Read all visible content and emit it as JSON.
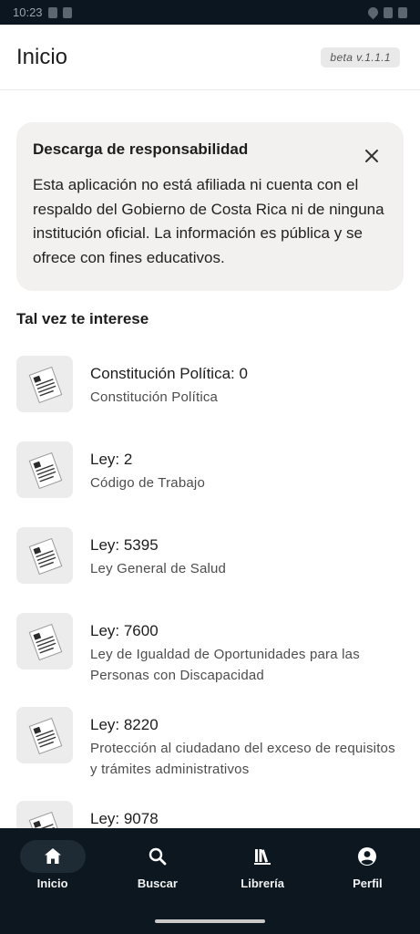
{
  "status_bar": {
    "time": "10:23"
  },
  "app_bar": {
    "title": "Inicio",
    "version": "beta v.1.1.1"
  },
  "disclaimer": {
    "title": "Descarga de responsabilidad",
    "body": "Esta aplicación no está afiliada ni cuenta con el respaldo del Gobierno de Costa Rica ni de ninguna institución oficial. La información es pública y se ofrece con fines educativos."
  },
  "section": {
    "title": "Tal vez te interese"
  },
  "items": [
    {
      "title": "Constitución Política: 0",
      "subtitle": "Constitución Política",
      "icon": "document-icon"
    },
    {
      "title": "Ley: 2",
      "subtitle": "Código de Trabajo",
      "icon": "document-icon"
    },
    {
      "title": "Ley: 5395",
      "subtitle": "Ley General de Salud",
      "icon": "document-icon"
    },
    {
      "title": "Ley: 7600",
      "subtitle": "Ley de Igualdad de Oportunidades para las Personas con Discapacidad",
      "icon": "document-icon"
    },
    {
      "title": "Ley: 8220",
      "subtitle": "Protección al ciudadano del exceso de requisitos y trámites administrativos",
      "icon": "document-icon"
    },
    {
      "title": "Ley: 9078",
      "subtitle": "",
      "icon": "document-icon"
    }
  ],
  "nav": {
    "items": [
      {
        "label": "Inicio",
        "icon": "home-icon",
        "active": true
      },
      {
        "label": "Buscar",
        "icon": "search-icon"
      },
      {
        "label": "Librería",
        "icon": "library-icon"
      },
      {
        "label": "Perfil",
        "icon": "account-icon"
      }
    ]
  },
  "colors": {
    "nav_background": "#0c1720",
    "card_background": "#f2f1ef",
    "text": "#1d1d1d"
  }
}
